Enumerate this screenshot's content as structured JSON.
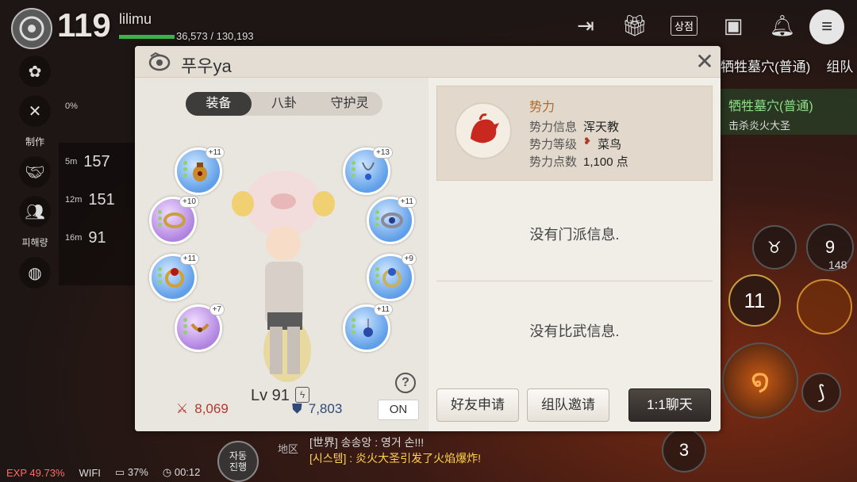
{
  "hud": {
    "level": "119",
    "name": "lilimu",
    "hp": "36,573 / 130,193",
    "shop_label": "상점",
    "right_tabs": [
      "牺牲墓穴(普通)",
      "组队"
    ],
    "quest_title": "牺牲墓穴(普通)",
    "quest_sub": "击杀炎火大圣",
    "side_labels": {
      "craft": "制作",
      "craft_pct": "0%",
      "damage": "피해량"
    },
    "mini_rows": [
      {
        "time": "5m",
        "num": "157"
      },
      {
        "time": "12m",
        "num": "151"
      },
      {
        "time": "16m",
        "num": "91"
      }
    ],
    "skills": {
      "s1": "11",
      "s2": "9",
      "s2_sub": "148",
      "s3": "3"
    },
    "auto_btn": "자동\n진행",
    "region": "地区",
    "chat": [
      {
        "text": "[世界] 송송앙 : 영거 손!!!",
        "sys": false
      },
      {
        "text": "[시스템] : 炎火大圣引发了火焰爆炸!",
        "sys": true
      }
    ],
    "bottom": {
      "exp": "EXP 49.73%",
      "wifi": "WIFI",
      "battery": "37%",
      "clock": "00:12"
    }
  },
  "modal": {
    "title": "푸우ya",
    "close": "✕",
    "tabs": [
      {
        "label": "装备",
        "active": true
      },
      {
        "label": "八卦",
        "active": false
      },
      {
        "label": "守护灵",
        "active": false
      }
    ],
    "equipment": [
      {
        "name": "pouch",
        "enh": "+11",
        "color": "blue"
      },
      {
        "name": "bracelet",
        "enh": "+10",
        "color": "purple"
      },
      {
        "name": "ring-left",
        "enh": "+11",
        "color": "blue"
      },
      {
        "name": "belt",
        "enh": "+7",
        "color": "purple"
      },
      {
        "name": "necklace",
        "enh": "+13",
        "color": "blue"
      },
      {
        "name": "bracelet-right",
        "enh": "+11",
        "color": "blue"
      },
      {
        "name": "ring-right",
        "enh": "+9",
        "color": "blue"
      },
      {
        "name": "earring",
        "enh": "+11",
        "color": "blue"
      }
    ],
    "level": "Lv 91",
    "attack": "8,069",
    "defense": "7,803",
    "toggle": "ON",
    "help": "?",
    "faction": {
      "title": "势力",
      "rows": [
        {
          "label": "势力信息",
          "value": "浑天教"
        },
        {
          "label": "势力等级",
          "value": "菜鸟"
        },
        {
          "label": "势力点数",
          "value": "1,100 点"
        }
      ]
    },
    "no_clan": "没有门派信息.",
    "no_duel": "没有比武信息.",
    "buttons": {
      "friend": "好友申请",
      "party": "组队邀请",
      "chat": "1:1聊天"
    }
  },
  "colors": {
    "accent_red": "#b03a2e",
    "defense_blue": "#2d4a7a",
    "faction_gold": "#b06a2a"
  }
}
